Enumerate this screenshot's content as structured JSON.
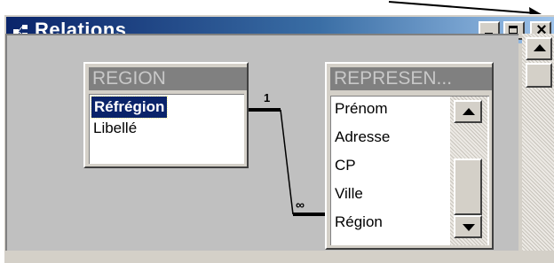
{
  "window": {
    "title": "Relations",
    "controls": {
      "minimize": "minimize",
      "maximize": "maximize",
      "close": "×"
    }
  },
  "tables": [
    {
      "name": "REGION",
      "fields": [
        "Réfrégion",
        "Libellé"
      ],
      "selected_field": "Réfrégion"
    },
    {
      "name": "REPRESEN...",
      "fields": [
        "Prénom",
        "Adresse",
        "CP",
        "Ville",
        "Région"
      ]
    }
  ],
  "relationship": {
    "one_side": "1",
    "many_side": "∞"
  },
  "colors": {
    "titlebar_start": "#0a246a",
    "titlebar_end": "#a6caf0",
    "selection": "#0a246a",
    "face": "#d4d0c8"
  }
}
